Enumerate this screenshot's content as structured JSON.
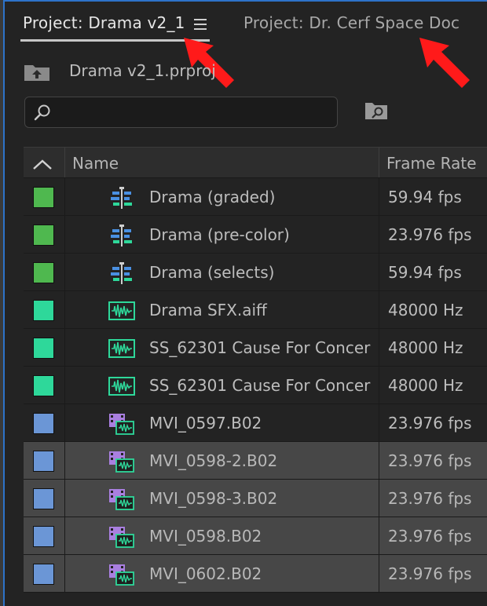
{
  "tabs": [
    {
      "label": "Project: Drama v2_1",
      "active": true
    },
    {
      "label": "Project: Dr. Cerf Space Doc",
      "active": false
    }
  ],
  "project_file": "Drama v2_1.prproj",
  "search": {
    "value": "",
    "placeholder": ""
  },
  "table": {
    "columns": [
      "Name",
      "Frame Rate"
    ],
    "rows": [
      {
        "name": "Drama (graded)",
        "rate": "59.94 fps",
        "type": "sequence",
        "label_color": "#4fb84f"
      },
      {
        "name": "Drama (pre-color)",
        "rate": "23.976 fps",
        "type": "sequence",
        "label_color": "#4fb84f"
      },
      {
        "name": "Drama (selects)",
        "rate": "59.94 fps",
        "type": "sequence",
        "label_color": "#4fb84f"
      },
      {
        "name": "Drama SFX.aiff",
        "rate": "48000 Hz",
        "type": "audio",
        "label_color": "#2ed89a"
      },
      {
        "name": "SS_62301 Cause For Concer",
        "rate": "48000 Hz",
        "type": "audio",
        "label_color": "#2ed89a"
      },
      {
        "name": "SS_62301 Cause For Concer",
        "rate": "48000 Hz",
        "type": "audio",
        "label_color": "#2ed89a"
      },
      {
        "name": "MVI_0597.B02",
        "rate": "23.976 fps",
        "type": "video",
        "label_color": "#6b96d6"
      },
      {
        "name": "MVI_0598-2.B02",
        "rate": "23.976 fps",
        "type": "video",
        "label_color": "#6b96d6",
        "selected": true
      },
      {
        "name": "MVI_0598-3.B02",
        "rate": "23.976 fps",
        "type": "video",
        "label_color": "#6b96d6",
        "selected": true
      },
      {
        "name": "MVI_0598.B02",
        "rate": "23.976 fps",
        "type": "video",
        "label_color": "#6b96d6",
        "selected": true
      },
      {
        "name": "MVI_0602.B02",
        "rate": "23.976 fps",
        "type": "video",
        "label_color": "#6b96d6",
        "selected": true
      }
    ]
  },
  "colors": {
    "accent": "#2d73c9",
    "annotation_arrow": "#ff1a1a"
  }
}
